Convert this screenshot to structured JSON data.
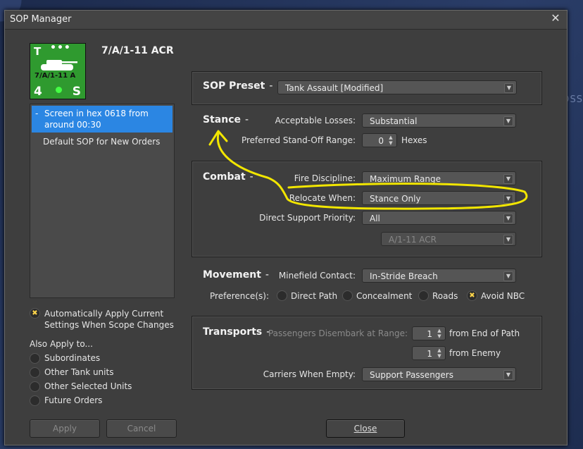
{
  "background": {
    "text": "OSS"
  },
  "window": {
    "title": "SOP Manager",
    "close_glyph": "✕"
  },
  "unit": {
    "icon": {
      "top_letter": "T",
      "dots": "•••",
      "label": "7/A/1-11 A",
      "bottom_left": "4",
      "bottom_right": "S"
    },
    "name": "7/A/1-11 ACR"
  },
  "sop_list": [
    {
      "label": "Screen in hex 0618 from around 00:30",
      "selected": true,
      "marker": "-"
    },
    {
      "label": "Default SOP for New Orders",
      "selected": false,
      "marker": ""
    }
  ],
  "auto_apply": {
    "label": "Automatically Apply Current Settings When Scope Changes",
    "checked": true
  },
  "also_apply": {
    "title": "Also Apply to...",
    "options": [
      {
        "label": "Subordinates",
        "checked": false
      },
      {
        "label": "Other Tank units",
        "checked": false
      },
      {
        "label": "Other Selected Units",
        "checked": false
      },
      {
        "label": "Future Orders",
        "checked": false
      }
    ]
  },
  "buttons": {
    "apply": "Apply",
    "cancel": "Cancel",
    "close": "Close"
  },
  "preset": {
    "heading": "SOP Preset",
    "value": "Tank Assault [Modified]"
  },
  "stance": {
    "heading": "Stance",
    "acceptable_losses_label": "Acceptable Losses:",
    "acceptable_losses": "Substantial",
    "standoff_label": "Preferred Stand-Off Range:",
    "standoff_value": "0",
    "standoff_unit": "Hexes"
  },
  "combat": {
    "heading": "Combat",
    "fire_label": "Fire Discipline:",
    "fire_value": "Maximum Range",
    "relocate_label": "Relocate When:",
    "relocate_value": "Stance Only",
    "dsp_label": "Direct Support Priority:",
    "dsp_value": "All",
    "dsp_unit_value": "A/1-11 ACR"
  },
  "movement": {
    "heading": "Movement",
    "minefield_label": "Minefield Contact:",
    "minefield_value": "In-Stride Breach",
    "preferences_label": "Preference(s):",
    "preferences": [
      {
        "label": "Direct Path",
        "checked": false
      },
      {
        "label": "Concealment",
        "checked": false
      },
      {
        "label": "Roads",
        "checked": false
      },
      {
        "label": "Avoid NBC",
        "checked": true
      }
    ]
  },
  "transports": {
    "heading": "Transports",
    "disembark_label": "Passengers Disembark at Range:",
    "end_of_path_value": "1",
    "end_of_path_label": "from End of Path",
    "from_enemy_value": "1",
    "from_enemy_label": "from Enemy",
    "carriers_label": "Carriers When Empty:",
    "carriers_value": "Support Passengers"
  },
  "colors": {
    "annotation": "#f2e600",
    "selection": "#2b86e3",
    "unit_green": "#2f9a2f"
  }
}
